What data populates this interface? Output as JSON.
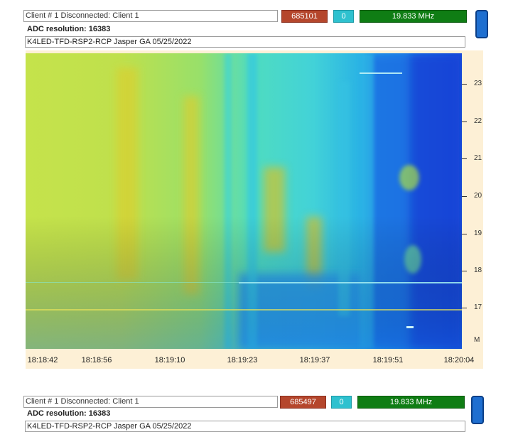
{
  "panel1": {
    "status_text": "Client # 1 Disconnected: Client 1",
    "counter": "685101",
    "zero_value": "0",
    "frequency": "19.833 MHz",
    "adc_label": "ADC resolution:",
    "adc_value": "16383",
    "station_text": "K4LED-TFD-RSP2-RCP   Jasper GA    05/25/2022",
    "y_ticks": [
      "23",
      "22",
      "21",
      "20",
      "19",
      "18",
      "17",
      "M"
    ],
    "x_ticks": [
      "18:18:42",
      "18:18:56",
      "18:19:10",
      "18:19:23",
      "18:19:37",
      "18:19:51",
      "18:20:04"
    ]
  },
  "panel2": {
    "status_text": "Client # 1 Disconnected: Client 1",
    "counter": "685497",
    "zero_value": "0",
    "frequency": "19.833 MHz",
    "adc_label": "ADC resolution:",
    "adc_value": "16383",
    "station_text": "K4LED-TFD-RSP2-RCP   Jasper GA    05/25/2022"
  },
  "colors": {
    "counter_bg": "#b5462c",
    "zero_bg": "#2ec1cf",
    "freq_bg": "#0f7d14",
    "axis_bg": "#fdf0d6",
    "spectrogram_low": "#1e4fd6",
    "spectrogram_mid": "#2fd8e0",
    "spectrogram_high": "#c8e04a"
  }
}
